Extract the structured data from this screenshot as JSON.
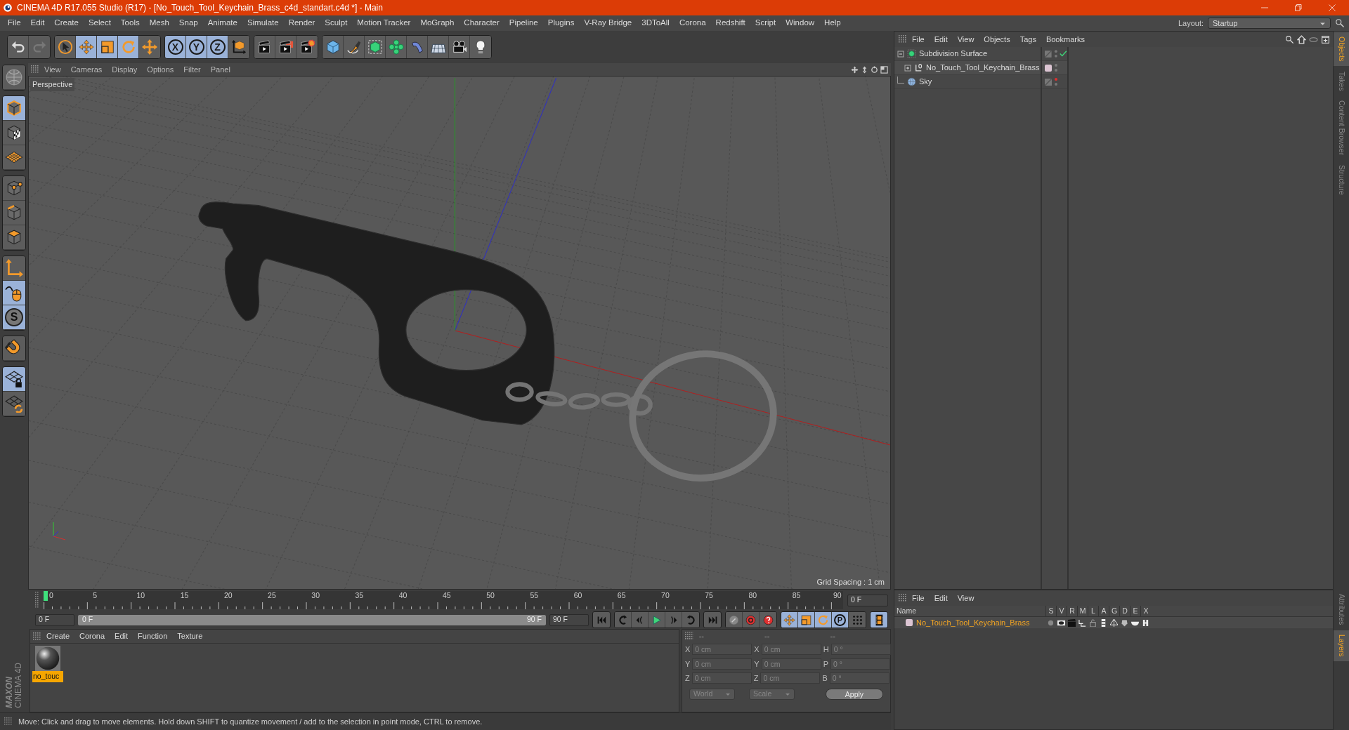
{
  "window": {
    "title": "CINEMA 4D R17.055 Studio (R17) - [No_Touch_Tool_Keychain_Brass_c4d_standart.c4d *] - Main"
  },
  "menu": [
    "File",
    "Edit",
    "Create",
    "Select",
    "Tools",
    "Mesh",
    "Snap",
    "Animate",
    "Simulate",
    "Render",
    "Sculpt",
    "Motion Tracker",
    "MoGraph",
    "Character",
    "Pipeline",
    "Plugins",
    "V-Ray Bridge",
    "3DToAll",
    "Corona",
    "Redshift",
    "Script",
    "Window",
    "Help"
  ],
  "layout": {
    "label": "Layout:",
    "value": "Startup"
  },
  "toolbar": [
    [
      {
        "kind": "undo",
        "selected": false,
        "disabled": false
      },
      {
        "kind": "redo",
        "selected": false,
        "disabled": true
      }
    ],
    [
      {
        "kind": "select",
        "selected": false,
        "disabled": false
      },
      {
        "kind": "move",
        "selected": true,
        "disabled": false
      },
      {
        "kind": "scale",
        "selected": true,
        "disabled": false
      },
      {
        "kind": "rotate",
        "selected": true,
        "disabled": false
      },
      {
        "kind": "transform",
        "selected": false,
        "disabled": false
      }
    ],
    [
      {
        "kind": "axis",
        "label": "X",
        "selected": true,
        "disabled": false
      },
      {
        "kind": "axis",
        "label": "Y",
        "selected": true,
        "disabled": false
      },
      {
        "kind": "axis",
        "label": "Z",
        "selected": true,
        "disabled": false
      },
      {
        "kind": "coords",
        "selected": false,
        "disabled": false
      }
    ],
    [
      {
        "kind": "render-view",
        "selected": false,
        "disabled": false
      },
      {
        "kind": "render",
        "selected": false,
        "disabled": false
      },
      {
        "kind": "render-settings",
        "selected": false,
        "disabled": false
      }
    ],
    [
      {
        "kind": "cube",
        "selected": false,
        "disabled": false
      },
      {
        "kind": "pen",
        "selected": false,
        "disabled": false
      },
      {
        "kind": "subdivide",
        "selected": false,
        "disabled": false
      },
      {
        "kind": "cloner",
        "selected": false,
        "disabled": false
      },
      {
        "kind": "deformer",
        "selected": false,
        "disabled": false
      },
      {
        "kind": "floor",
        "selected": false,
        "disabled": false
      },
      {
        "kind": "camera",
        "selected": false,
        "disabled": false
      },
      {
        "kind": "light",
        "selected": false,
        "disabled": false
      }
    ]
  ],
  "tools": [
    [
      {
        "kind": "globe",
        "selected": false
      }
    ],
    [
      {
        "kind": "model",
        "selected": true
      },
      {
        "kind": "texture",
        "selected": false
      },
      {
        "kind": "workplane",
        "selected": false
      }
    ],
    [
      {
        "kind": "points",
        "selected": false
      },
      {
        "kind": "edges",
        "selected": false
      },
      {
        "kind": "polygons",
        "selected": false
      }
    ],
    [
      {
        "kind": "axis",
        "selected": false
      },
      {
        "kind": "tweak",
        "selected": true
      },
      {
        "kind": "snap",
        "label": "S",
        "selected": true
      }
    ],
    [
      {
        "kind": "magnet",
        "selected": false
      }
    ],
    [
      {
        "kind": "grid-lock",
        "selected": true
      },
      {
        "kind": "grid-sync",
        "selected": false
      }
    ]
  ],
  "viewport": {
    "menu": [
      "View",
      "Cameras",
      "Display",
      "Options",
      "Filter",
      "Panel"
    ],
    "camera": "Perspective",
    "grid_spacing": "Grid Spacing : 1 cm"
  },
  "timeline": {
    "ticks": [
      "0",
      "5",
      "10",
      "15",
      "20",
      "25",
      "30",
      "35",
      "40",
      "45",
      "50",
      "55",
      "60",
      "65",
      "70",
      "75",
      "80",
      "85",
      "90"
    ],
    "level": 0,
    "current": "0 F",
    "start": "0 F",
    "range": {
      "start": "0 F",
      "end": "90 F",
      "level": 1
    },
    "end": "90 F"
  },
  "transport": [
    [
      {
        "kind": "start",
        "selected": false
      }
    ],
    [
      {
        "kind": "prev-key",
        "selected": false
      },
      {
        "kind": "prev-frame",
        "selected": false
      },
      {
        "kind": "play",
        "selected": false
      },
      {
        "kind": "next-frame",
        "selected": false
      },
      {
        "kind": "next-key",
        "selected": false
      }
    ],
    [
      {
        "kind": "end",
        "selected": false
      }
    ],
    [
      {
        "kind": "key",
        "selected": false
      },
      {
        "kind": "record",
        "selected": false
      },
      {
        "kind": "auto",
        "selected": false
      }
    ],
    [
      {
        "kind": "move",
        "selected": true
      },
      {
        "kind": "scale",
        "selected": true
      },
      {
        "kind": "rotate",
        "selected": true
      },
      {
        "kind": "param",
        "label": "P",
        "selected": true
      },
      {
        "kind": "dots",
        "selected": false
      }
    ],
    [
      {
        "kind": "film",
        "selected": true
      }
    ]
  ],
  "materials": {
    "menu": [
      "Create",
      "Corona",
      "Edit",
      "Function",
      "Texture"
    ],
    "items": [
      {
        "name": "no_touc",
        "selected": true
      }
    ]
  },
  "coordinates": {
    "headers": [
      "--",
      "--",
      "--"
    ],
    "rows": [
      [
        {
          "label": "X",
          "value": "0 cm"
        },
        {
          "label": "X",
          "value": "0 cm"
        },
        {
          "label": "H",
          "value": "0 °"
        }
      ],
      [
        {
          "label": "Y",
          "value": "0 cm"
        },
        {
          "label": "Y",
          "value": "0 cm"
        },
        {
          "label": "P",
          "value": "0 °"
        }
      ],
      [
        {
          "label": "Z",
          "value": "0 cm"
        },
        {
          "label": "Z",
          "value": "0 cm"
        },
        {
          "label": "B",
          "value": "0 °"
        }
      ]
    ],
    "dropdowns": [
      "World",
      "Scale"
    ],
    "apply": "Apply"
  },
  "logo": [
    "MAXON",
    "CINEMA 4D"
  ],
  "status_bar": "Move: Click and drag to move elements. Hold down SHIFT to quantize movement / add to the selection in point mode, CTRL to remove.",
  "objects": {
    "menu": [
      "File",
      "Edit",
      "View",
      "Objects",
      "Tags",
      "Bookmarks"
    ],
    "items": [
      {
        "name": "Subdivision Surface",
        "kind": "subdivision",
        "expanded": true,
        "enabled": true,
        "hidden_in_editor": false,
        "children": [
          {
            "name": "No_Touch_Tool_Keychain_Brass",
            "kind": "null",
            "expanded": false,
            "enabled": false,
            "hidden_in_editor": false,
            "color": "#dcc5d3"
          }
        ]
      },
      {
        "name": "Sky",
        "kind": "sky",
        "enabled": false,
        "hidden_in_editor": true
      }
    ]
  },
  "side_tabs": [
    {
      "label": "Objects",
      "selected": true
    },
    {
      "label": "Takes",
      "selected": false
    },
    {
      "label": "Content Browser",
      "selected": false
    },
    {
      "label": "Structure",
      "selected": false
    }
  ],
  "layers": {
    "menu": [
      "File",
      "Edit",
      "View"
    ],
    "columns": [
      "Name",
      "S",
      "V",
      "R",
      "M",
      "L",
      "A",
      "G",
      "D",
      "E",
      "X"
    ],
    "rows": [
      {
        "name": "No_Touch_Tool_Keychain_Brass",
        "color": "#dcc5d3",
        "selected": true
      }
    ]
  },
  "side_tabs_bottom": [
    {
      "label": "Attributes",
      "selected": false
    },
    {
      "label": "Layers",
      "selected": true
    }
  ]
}
